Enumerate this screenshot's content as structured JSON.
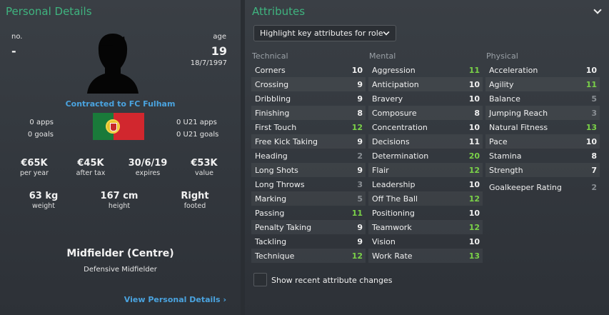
{
  "personal": {
    "title": "Personal Details",
    "no_label": "no.",
    "no_value": "-",
    "age_label": "age",
    "age_value": "19",
    "dob": "18/7/1997",
    "contract": "Contracted to FC Fulham",
    "apps": "0 apps",
    "goals": "0 goals",
    "u21_apps": "0 U21 apps",
    "u21_goals": "0 U21 goals",
    "finance": [
      {
        "value": "€65K",
        "label": "per year"
      },
      {
        "value": "€45K",
        "label": "after tax"
      },
      {
        "value": "30/6/19",
        "label": "expires"
      },
      {
        "value": "€53K",
        "label": "value"
      }
    ],
    "physical": [
      {
        "value": "63 kg",
        "label": "weight"
      },
      {
        "value": "167 cm",
        "label": "height"
      },
      {
        "value": "Right",
        "label": "footed"
      }
    ],
    "position": "Midfielder (Centre)",
    "role": "Defensive Midfielder",
    "view_link": "View Personal Details",
    "link_arrow": "›"
  },
  "attributes": {
    "title": "Attributes",
    "dropdown_label": "Highlight key attributes for role",
    "checkbox_label": "Show recent attribute changes",
    "technical": {
      "header": "Technical",
      "items": [
        {
          "name": "Corners",
          "value": "10",
          "tone": "mid"
        },
        {
          "name": "Crossing",
          "value": "9",
          "tone": "mid"
        },
        {
          "name": "Dribbling",
          "value": "9",
          "tone": "mid"
        },
        {
          "name": "Finishing",
          "value": "8",
          "tone": "mid"
        },
        {
          "name": "First Touch",
          "value": "12",
          "tone": "hi"
        },
        {
          "name": "Free Kick Taking",
          "value": "9",
          "tone": "mid"
        },
        {
          "name": "Heading",
          "value": "2",
          "tone": "lo"
        },
        {
          "name": "Long Shots",
          "value": "9",
          "tone": "mid"
        },
        {
          "name": "Long Throws",
          "value": "3",
          "tone": "lo"
        },
        {
          "name": "Marking",
          "value": "5",
          "tone": "lo"
        },
        {
          "name": "Passing",
          "value": "11",
          "tone": "hi"
        },
        {
          "name": "Penalty Taking",
          "value": "9",
          "tone": "mid"
        },
        {
          "name": "Tackling",
          "value": "9",
          "tone": "mid"
        },
        {
          "name": "Technique",
          "value": "12",
          "tone": "hi"
        }
      ]
    },
    "mental": {
      "header": "Mental",
      "items": [
        {
          "name": "Aggression",
          "value": "11",
          "tone": "hi"
        },
        {
          "name": "Anticipation",
          "value": "10",
          "tone": "mid"
        },
        {
          "name": "Bravery",
          "value": "10",
          "tone": "mid"
        },
        {
          "name": "Composure",
          "value": "8",
          "tone": "mid"
        },
        {
          "name": "Concentration",
          "value": "10",
          "tone": "mid"
        },
        {
          "name": "Decisions",
          "value": "11",
          "tone": "mid"
        },
        {
          "name": "Determination",
          "value": "20",
          "tone": "hi"
        },
        {
          "name": "Flair",
          "value": "12",
          "tone": "hi"
        },
        {
          "name": "Leadership",
          "value": "10",
          "tone": "mid"
        },
        {
          "name": "Off The Ball",
          "value": "12",
          "tone": "hi"
        },
        {
          "name": "Positioning",
          "value": "10",
          "tone": "mid"
        },
        {
          "name": "Teamwork",
          "value": "12",
          "tone": "hi"
        },
        {
          "name": "Vision",
          "value": "10",
          "tone": "mid"
        },
        {
          "name": "Work Rate",
          "value": "13",
          "tone": "hi"
        }
      ]
    },
    "physical": {
      "header": "Physical",
      "items": [
        {
          "name": "Acceleration",
          "value": "10",
          "tone": "mid"
        },
        {
          "name": "Agility",
          "value": "11",
          "tone": "hi"
        },
        {
          "name": "Balance",
          "value": "5",
          "tone": "lo"
        },
        {
          "name": "Jumping Reach",
          "value": "3",
          "tone": "lo"
        },
        {
          "name": "Natural Fitness",
          "value": "13",
          "tone": "hi"
        },
        {
          "name": "Pace",
          "value": "10",
          "tone": "mid"
        },
        {
          "name": "Stamina",
          "value": "8",
          "tone": "mid"
        },
        {
          "name": "Strength",
          "value": "7",
          "tone": "mid"
        }
      ],
      "goalkeeper_label": "Goalkeeper Rating",
      "goalkeeper_value": "2"
    }
  },
  "colors": {
    "title_green": "#3fb37f",
    "link_blue": "#4aa3df",
    "high_value": "#7ad148",
    "low_value": "#8a8f94"
  }
}
